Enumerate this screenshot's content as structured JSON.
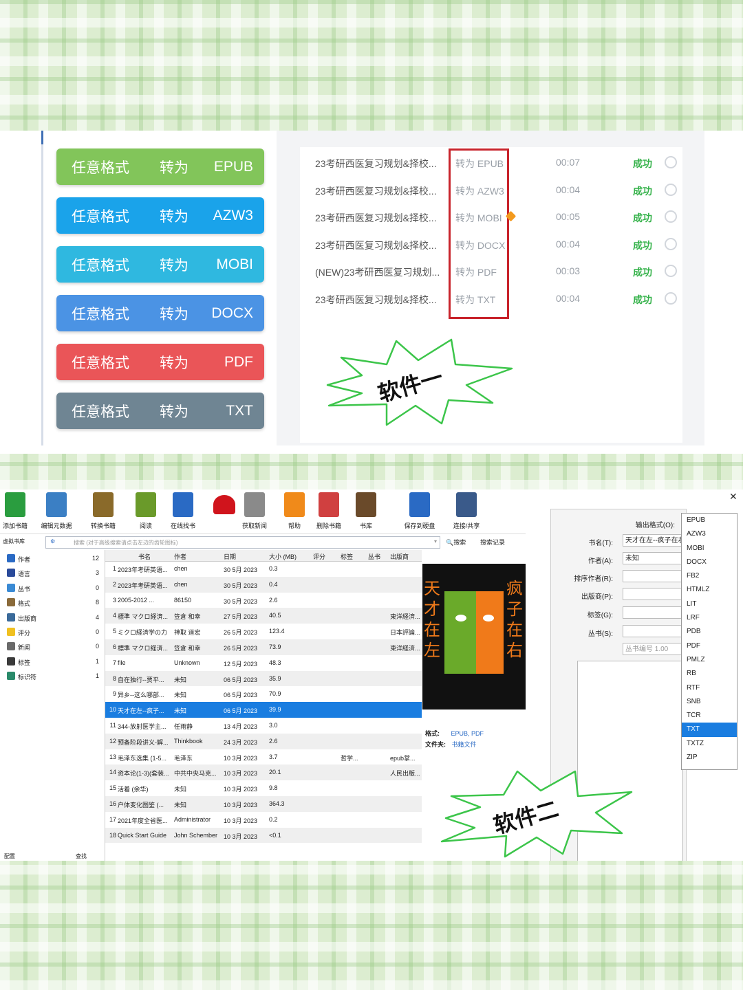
{
  "software1": {
    "convert_buttons": [
      {
        "from": "任意格式",
        "verb": "转为",
        "to": "EPUB",
        "color": "#82c55a"
      },
      {
        "from": "任意格式",
        "verb": "转为",
        "to": "AZW3",
        "color": "#1aa3ea"
      },
      {
        "from": "任意格式",
        "verb": "转为",
        "to": "MOBI",
        "color": "#2fb8e0"
      },
      {
        "from": "任意格式",
        "verb": "转为",
        "to": "DOCX",
        "color": "#4b93e4"
      },
      {
        "from": "任意格式",
        "verb": "转为",
        "to": "PDF",
        "color": "#ea5558"
      },
      {
        "from": "任意格式",
        "verb": "转为",
        "to": "TXT",
        "color": "#6f8593"
      }
    ],
    "tasks": [
      {
        "file": "23考研西医复习规划&择校...",
        "format": "转为 EPUB",
        "time": "00:07",
        "status": "成功"
      },
      {
        "file": "23考研西医复习规划&择校...",
        "format": "转为 AZW3",
        "time": "00:04",
        "status": "成功"
      },
      {
        "file": "23考研西医复习规划&择校...",
        "format": "转为 MOBI",
        "time": "00:05",
        "status": "成功"
      },
      {
        "file": "23考研西医复习规划&择校...",
        "format": "转为 DOCX",
        "time": "00:04",
        "status": "成功"
      },
      {
        "file": "(NEW)23考研西医复习规划...",
        "format": "转为 PDF",
        "time": "00:03",
        "status": "成功"
      },
      {
        "file": "23考研西医复习规划&择校...",
        "format": "转为 TXT",
        "time": "00:04",
        "status": "成功"
      }
    ],
    "badge": "软件一"
  },
  "software2": {
    "toolbar": [
      {
        "label": "添加书籍",
        "icon": "add-book-icon",
        "color": "#2a9d3f"
      },
      {
        "label": "编辑元数据",
        "icon": "edit-metadata-icon",
        "color": "#3b7fc4"
      },
      {
        "label": "转换书籍",
        "icon": "convert-book-icon",
        "color": "#8a6a2a"
      },
      {
        "label": "阅读",
        "icon": "read-icon",
        "color": "#6a9a2a"
      },
      {
        "label": "在线找书",
        "icon": "download-icon",
        "color": "#2a6ac4"
      },
      {
        "label": "",
        "icon": "heart-icon",
        "color": "#d0141c"
      },
      {
        "label": "获取新闻",
        "icon": "news-icon",
        "color": "#8a8a8a"
      },
      {
        "label": "帮助",
        "icon": "help-icon",
        "color": "#f08a1a"
      },
      {
        "label": "删除书籍",
        "icon": "delete-icon",
        "color": "#d04040"
      },
      {
        "label": "书库",
        "icon": "library-icon",
        "color": "#6a4a2a"
      },
      {
        "label": "保存到硬盘",
        "icon": "save-icon",
        "color": "#2a6ac4"
      },
      {
        "label": "连接/共享",
        "icon": "share-icon",
        "color": "#3a5a8a"
      }
    ],
    "search_placeholder": "搜索 (对于高级搜索请点击左边的齿轮图标)",
    "search_button": "搜索",
    "saved_search": "搜索记录",
    "virtual_library": "虚拟书库",
    "sidebar": [
      {
        "label": "作者",
        "count": "12",
        "color": "#2a6ac4"
      },
      {
        "label": "语言",
        "count": "3",
        "color": "#2a4a9a"
      },
      {
        "label": "丛书",
        "count": "0",
        "color": "#3a8ad4"
      },
      {
        "label": "格式",
        "count": "8",
        "color": "#8a6a3a"
      },
      {
        "label": "出版商",
        "count": "4",
        "color": "#3a6a9a"
      },
      {
        "label": "评分",
        "count": "0",
        "color": "#f0c020"
      },
      {
        "label": "新闻",
        "count": "0",
        "color": "#6a6a6a"
      },
      {
        "label": "标签",
        "count": "1",
        "color": "#3a3a3a"
      },
      {
        "label": "标识符",
        "count": "1",
        "color": "#2a8a6a"
      }
    ],
    "sidebar_footer": [
      "配置",
      "查找"
    ],
    "columns": [
      "书名",
      "作者",
      "日期",
      "大小 (MB)",
      "评分",
      "标签",
      "丛书",
      "出版商"
    ],
    "books": [
      {
        "n": "1",
        "title": "2023年考研英语...",
        "author": "chen",
        "date": "30 5月 2023",
        "size": "0.3",
        "tags": "",
        "pub": ""
      },
      {
        "n": "2",
        "title": "2023年考研英语...",
        "author": "chen",
        "date": "30 5月 2023",
        "size": "0.4",
        "tags": "",
        "pub": ""
      },
      {
        "n": "3",
        "title": "2005-2012 ...",
        "author": "86150",
        "date": "30 5月 2023",
        "size": "2.6",
        "tags": "",
        "pub": ""
      },
      {
        "n": "4",
        "title": "標準 マクロ経済...",
        "author": "笠倉 和幸",
        "date": "27 5月 2023",
        "size": "40.5",
        "tags": "",
        "pub": "東洋経済..."
      },
      {
        "n": "5",
        "title": "ミクロ経済学の力",
        "author": "神取 道宏",
        "date": "26 5月 2023",
        "size": "123.4",
        "tags": "",
        "pub": "日本評論..."
      },
      {
        "n": "6",
        "title": "標準 マクロ経済...",
        "author": "笠倉 和幸",
        "date": "26 5月 2023",
        "size": "73.9",
        "tags": "",
        "pub": "東洋経済..."
      },
      {
        "n": "7",
        "title": "file",
        "author": "Unknown",
        "date": "12 5月 2023",
        "size": "48.3",
        "tags": "",
        "pub": ""
      },
      {
        "n": "8",
        "title": "自在独行--贾平...",
        "author": "未知",
        "date": "06 5月 2023",
        "size": "35.9",
        "tags": "",
        "pub": ""
      },
      {
        "n": "9",
        "title": "异乡--这么哪部...",
        "author": "未知",
        "date": "06 5月 2023",
        "size": "70.9",
        "tags": "",
        "pub": ""
      },
      {
        "n": "10",
        "title": "天才在左--疯子...",
        "author": "未知",
        "date": "06 5月 2023",
        "size": "39.9",
        "tags": "",
        "pub": ""
      },
      {
        "n": "11",
        "title": "344-放射医学主...",
        "author": "任雨静",
        "date": "13 4月 2023",
        "size": "3.0",
        "tags": "",
        "pub": ""
      },
      {
        "n": "12",
        "title": "预备阶段讲义-解...",
        "author": "Thinkbook",
        "date": "24 3月 2023",
        "size": "2.6",
        "tags": "",
        "pub": ""
      },
      {
        "n": "13",
        "title": "毛泽东选集 (1-5...",
        "author": "毛泽东",
        "date": "10 3月 2023",
        "size": "3.7",
        "tags": "哲学...",
        "pub": "epub掌..."
      },
      {
        "n": "14",
        "title": "资本论(1-3)(套装...",
        "author": "中共中央马克...",
        "date": "10 3月 2023",
        "size": "20.1",
        "tags": "",
        "pub": "人民出版..."
      },
      {
        "n": "15",
        "title": "活着 (余华)",
        "author": "未知",
        "date": "10 3月 2023",
        "size": "9.8",
        "tags": "",
        "pub": ""
      },
      {
        "n": "16",
        "title": "户体变化图鉴 (...",
        "author": "未知",
        "date": "10 3月 2023",
        "size": "364.3",
        "tags": "",
        "pub": ""
      },
      {
        "n": "17",
        "title": "2021年度全省医...",
        "author": "Administrator",
        "date": "10 3月 2023",
        "size": "0.2",
        "tags": "",
        "pub": ""
      },
      {
        "n": "18",
        "title": "Quick Start Guide",
        "author": "John Schember",
        "date": "10 3月 2023",
        "size": "<0.1",
        "tags": "",
        "pub": ""
      }
    ],
    "selected_row": 10,
    "cover": {
      "left": "天才在左",
      "right": "疯子在右"
    },
    "book_meta": {
      "formats_label": "格式:",
      "formats": "EPUB, PDF",
      "folder_label": "文件夹:",
      "folder": "书籍文件"
    },
    "form": {
      "output_format_label": "输出格式(O):",
      "title_label": "书名(T):",
      "title_value": "天才在左--疯子在右",
      "author_label": "作者(A):",
      "author_value": "未知",
      "author_sort_label": "排序作者(R):",
      "publisher_label": "出版商(P):",
      "tags_label": "标签(G):",
      "series_label": "丛书(S):",
      "series_number": "丛书编号 1.00"
    },
    "formats": [
      "EPUB",
      "AZW3",
      "MOBI",
      "DOCX",
      "FB2",
      "HTMLZ",
      "LIT",
      "LRF",
      "PDB",
      "PDF",
      "PMLZ",
      "RB",
      "RTF",
      "SNB",
      "TCR",
      "TXT",
      "TXTZ",
      "ZIP"
    ],
    "selected_format": "TXT",
    "badge": "软件二"
  }
}
